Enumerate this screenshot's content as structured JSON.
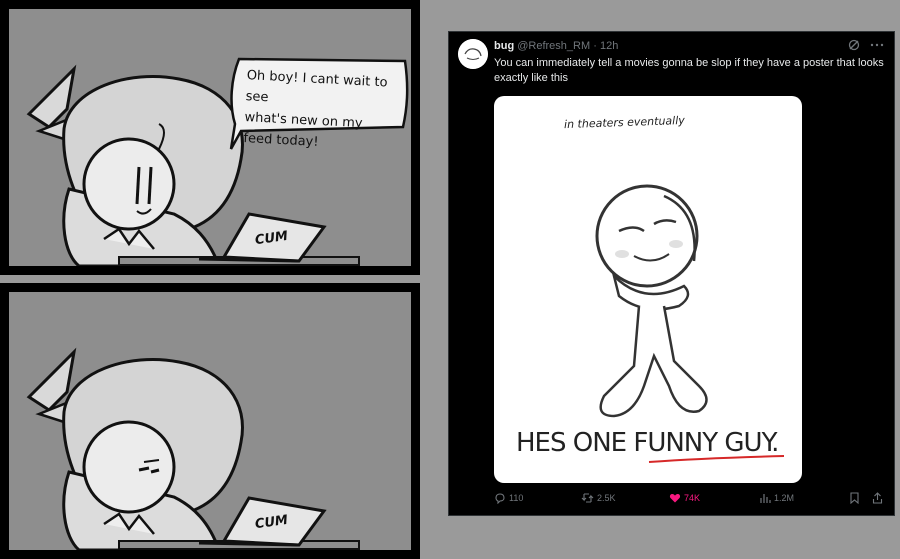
{
  "comic": {
    "speech_line1": "Oh boy! I cant wait to see",
    "speech_line2": "what's new on my feed today!",
    "laptop_top": "CUM",
    "laptop_bottom": "CUM"
  },
  "tweet": {
    "display_name": "bug",
    "handle": "@Refresh_RM",
    "separator": "·",
    "time": "12h",
    "text": "You can immediately tell a movies gonna be slop if they have a poster that looks exactly like this",
    "grok_icon": "grok-icon",
    "more_icon": "more-icon",
    "poster": {
      "top_caption": "in theaters eventually",
      "tagline_plain": "HES ONE ",
      "tagline_underlined": "FUNNY GUY."
    },
    "actions": {
      "replies": "110",
      "reposts": "2.5K",
      "likes": "74K",
      "views": "1.2M"
    },
    "like_color": "#f91880"
  }
}
